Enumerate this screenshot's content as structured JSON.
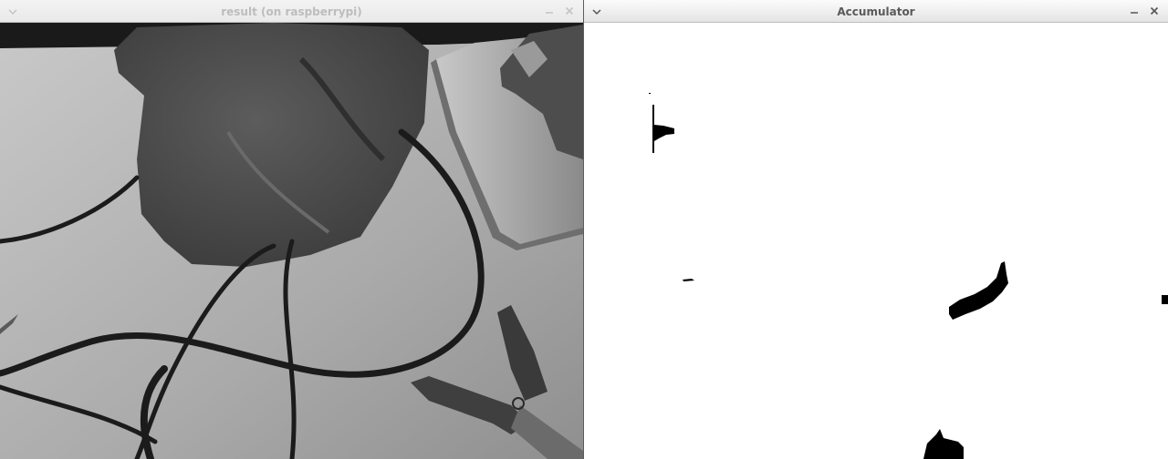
{
  "left_window": {
    "title": "result (on raspberrypi)",
    "menu_icon": "chevron-down-icon",
    "minimize_icon": "minimize-icon",
    "close_icon": "close-icon"
  },
  "right_window": {
    "title": "Accumulator",
    "menu_icon": "chevron-down-icon",
    "minimize_icon": "minimize-icon",
    "close_icon": "close-icon"
  },
  "colors": {
    "titlebar_active": "#eeeeee",
    "title_active": "#5a5a5a",
    "title_inactive": "#bdbdbd",
    "accumulator_background": "#ffffff",
    "accumulator_blobs": "#000000"
  }
}
